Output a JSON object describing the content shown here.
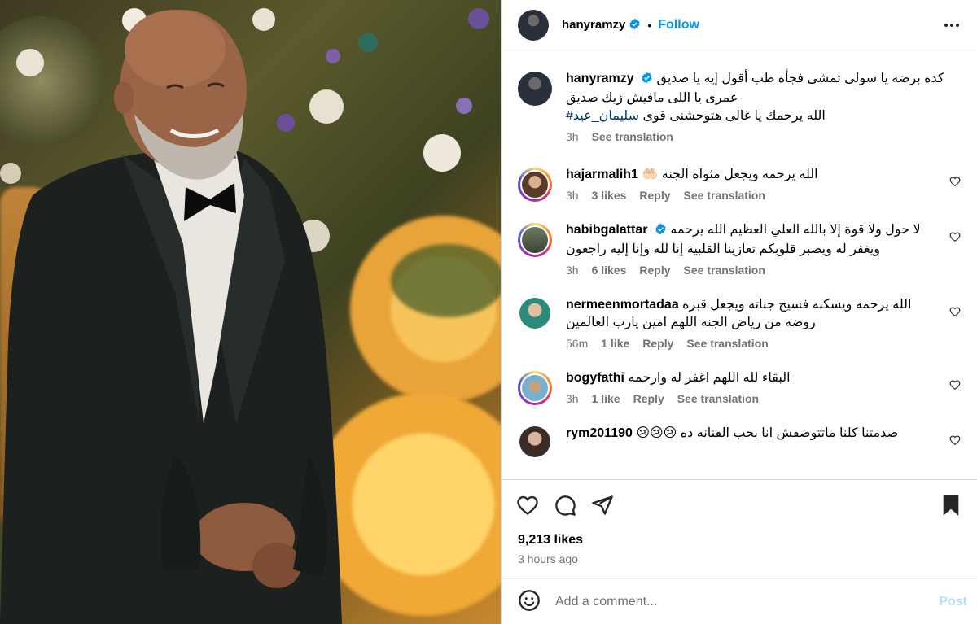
{
  "post": {
    "username": "hanyramzy",
    "verified": true,
    "separator": "•",
    "follow_label": "Follow",
    "more_icon": "more-horizontal-icon"
  },
  "caption": {
    "username": "hanyramzy",
    "lines": [
      "كده برضه يا سولى تمشى فجأه طب أقول إيه يا صديق",
      "عمرى يا اللى مافيش زيك صديق",
      "الله يرحمك يا غالى هتوحشنى قوى"
    ],
    "hashtag": "#سليمان_عيد",
    "time": "3h",
    "translate_label": "See translation"
  },
  "comments": [
    {
      "username": "hajarmalih1",
      "text_lines": [
        "الله يرحمه ويجعل مثواه الجنة 🤲🏻"
      ],
      "time": "3h",
      "likes": "3 likes",
      "reply_label": "Reply",
      "translate_label": "See translation"
    },
    {
      "username": "habibgalattar",
      "verified": true,
      "text_lines": [
        "لا حول ولا قوة إلا بالله العلي العظيم الله يرحمه",
        "ويغفر له ويصبر قلوبكم تعازينا القلبية إنا لله وإنا إليه راجعون"
      ],
      "time": "3h",
      "likes": "6 likes",
      "reply_label": "Reply",
      "translate_label": "See translation"
    },
    {
      "username": "nermeenmortadaa",
      "text_lines": [
        "الله يرحمه ويسكنه فسيح جناته ويجعل قبره",
        "روضه من رياض الجنه اللهم امين يارب العالمين"
      ],
      "time": "56m",
      "likes": "1 like",
      "reply_label": "Reply",
      "translate_label": "See translation"
    },
    {
      "username": "bogyfathi",
      "text_lines": [
        "البقاء لله اللهم اغفر له وارحمه"
      ],
      "time": "3h",
      "likes": "1 like",
      "reply_label": "Reply",
      "translate_label": "See translation"
    },
    {
      "username": "rym201190",
      "text_lines": [
        "صدمتنا كلنا ماتتوصفش انا بحب الفنانه ده 😢😢😢"
      ],
      "time": "",
      "likes": "",
      "reply_label": "",
      "translate_label": ""
    }
  ],
  "actions": {
    "like_icon": "heart-icon",
    "comment_icon": "comment-icon",
    "share_icon": "send-icon",
    "save_icon": "bookmark-icon"
  },
  "stats": {
    "likes": "9,213 likes",
    "time_ago": "3 hours ago"
  },
  "add_comment": {
    "placeholder": "Add a comment...",
    "post_label": "Post",
    "emoji_icon": "emoji-icon"
  },
  "colors": {
    "link": "#0095f6",
    "muted": "#737373",
    "post_disabled": "#b2dffc",
    "hashtag": "#00376b"
  }
}
